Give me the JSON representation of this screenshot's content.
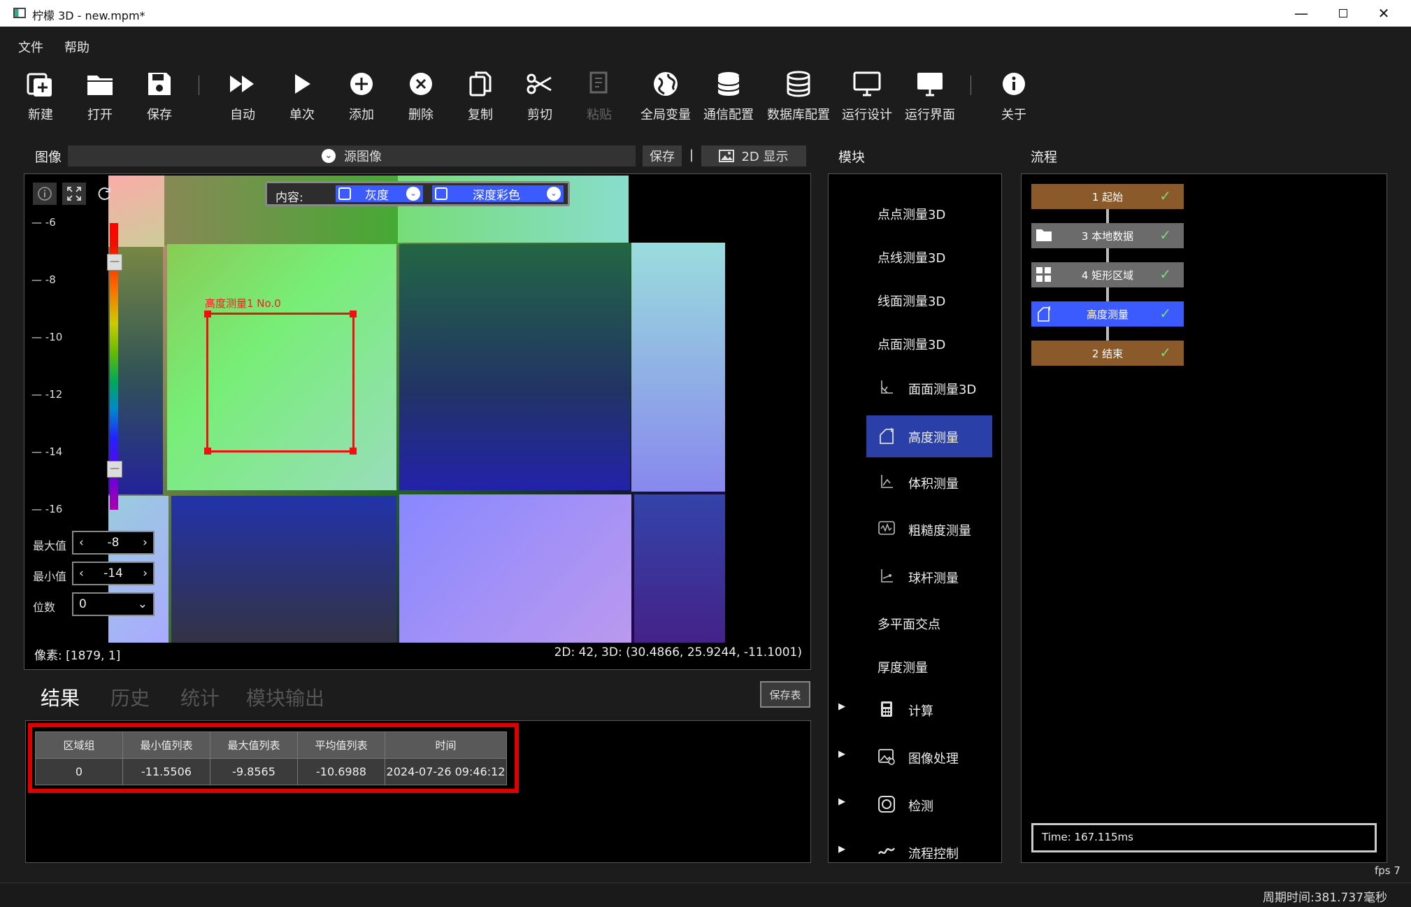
{
  "window": {
    "title": "柠檬 3D  - new.mpm*"
  },
  "menu": [
    "文件",
    "帮助"
  ],
  "toolbar": {
    "new": "新建",
    "open": "打开",
    "save": "保存",
    "auto": "自动",
    "single": "单次",
    "add": "添加",
    "delete": "删除",
    "copy": "复制",
    "cut": "剪切",
    "paste": "粘贴",
    "globals": "全局变量",
    "comm": "通信配置",
    "db": "数据库配置",
    "rundesign": "运行设计",
    "runui": "运行界面",
    "about": "关于"
  },
  "image_panel": {
    "title": "图像",
    "source_label": "源图像",
    "save_label": "保存",
    "separator": "|",
    "display_label": "2D 显示",
    "content_label": "内容:",
    "gray_label": "灰度",
    "depth_label": "深度彩色",
    "roi_label": "高度测量1 No.0",
    "ticks": [
      "-6",
      "-8",
      "-10",
      "-12",
      "-14",
      "-16"
    ],
    "max_label": "最大值",
    "max_value": "-8",
    "min_label": "最小值",
    "min_value": "-14",
    "digits_label": "位数",
    "digits_value": "0",
    "pixel_readout": "像素: [1879, 1]",
    "coord_readout": "2D: 42, 3D: (30.4866, 25.9244, -11.1001)",
    "colorbar_handle": "—"
  },
  "results": {
    "tabs": [
      "结果",
      "历史",
      "统计",
      "模块输出"
    ],
    "save_table": "保存表",
    "columns": [
      "区域组",
      "最小值列表",
      "最大值列表",
      "平均值列表",
      "时间"
    ],
    "rows": [
      [
        "0",
        "-11.5506",
        "-9.8565",
        "-10.6988",
        "2024-07-26 09:46:12"
      ]
    ]
  },
  "modules": {
    "title": "模块",
    "items": [
      "点点测量3D",
      "点线测量3D",
      "线面测量3D",
      "点面测量3D",
      "面面测量3D",
      "高度测量",
      "体积测量",
      "粗糙度测量",
      "球杆测量",
      "多平面交点",
      "厚度测量"
    ],
    "groups": [
      "计算",
      "图像处理",
      "检测",
      "流程控制"
    ],
    "expand_glyph": "▶"
  },
  "flow": {
    "title": "流程",
    "nodes": [
      "1 起始",
      "3 本地数据",
      "4 矩形区域",
      "高度测量",
      "2 结束"
    ],
    "check": "✓",
    "time": "Time: 167.115ms"
  },
  "status": {
    "fps": "fps 7",
    "cycle": "周期时间:381.737毫秒"
  },
  "colors": {
    "accent": "#3b5bff",
    "roi": "#e11111",
    "flow_brown": "#8a5a2b",
    "flow_gray": "#6b6b6b",
    "selected_module": "#2a3fa8",
    "result_highlight": "#e00000"
  }
}
